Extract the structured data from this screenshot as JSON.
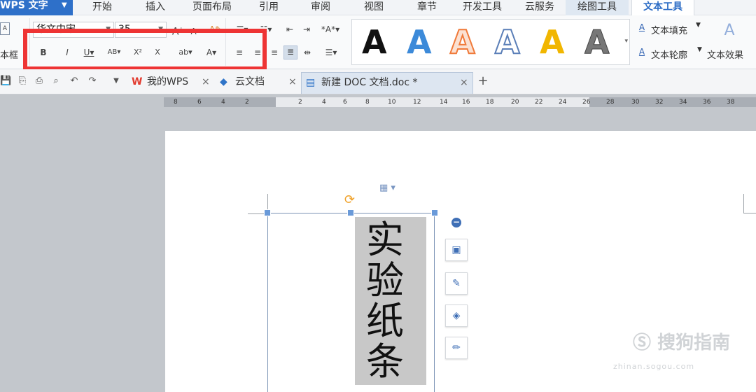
{
  "app": {
    "name": "WPS 文字"
  },
  "menu": {
    "items": [
      "开始",
      "插入",
      "页面布局",
      "引用",
      "审阅",
      "视图",
      "章节",
      "开发工具",
      "云服务",
      "绘图工具",
      "文本工具"
    ],
    "active": "文本工具"
  },
  "ribbon": {
    "font_name": "华文中宋",
    "font_size": "35",
    "left_label": "本框",
    "text_fill": "文本填充",
    "text_outline": "文本轮廓",
    "text_effect": "文本效果",
    "style_colors": [
      "#111111",
      "#3c8ad9",
      "#f07a3a",
      "#ffffff",
      "#f1b600",
      "#777777"
    ],
    "style_glyph": "A",
    "highlight_color": "#ee3434"
  },
  "tabs": [
    {
      "label": "我的WPS",
      "icon": "wps-logo-icon"
    },
    {
      "label": "云文档",
      "icon": "cloud-doc-icon"
    },
    {
      "label": "新建 DOC 文档.doc *",
      "icon": "doc-file-icon",
      "active": true
    }
  ],
  "ruler": {
    "labels": [
      "8",
      "6",
      "4",
      "2",
      "2",
      "4",
      "6",
      "8",
      "10",
      "12",
      "14",
      "16",
      "18",
      "20",
      "22",
      "24",
      "26",
      "28",
      "30",
      "32",
      "34",
      "36",
      "38"
    ]
  },
  "document": {
    "vertical_text": [
      "实",
      "验",
      "纸",
      "条"
    ]
  },
  "watermark": {
    "text": "搜狗指南",
    "sub": "zhinan.sogou.com"
  }
}
